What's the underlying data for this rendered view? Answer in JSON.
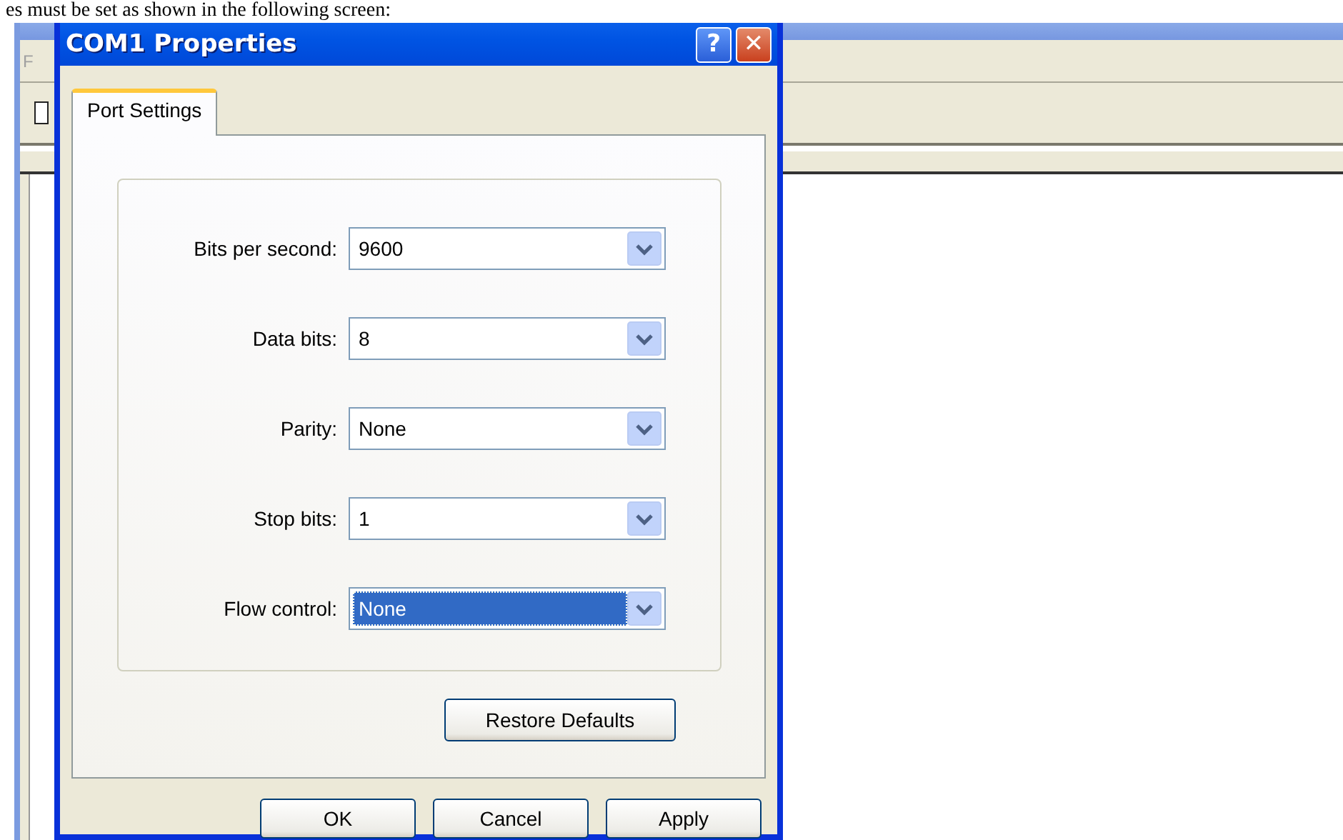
{
  "document": {
    "caption": "es must be set as shown in the following screen:"
  },
  "background_window": {
    "menu": [
      "F"
    ]
  },
  "dialog": {
    "title": "COM1 Properties",
    "title_buttons": [
      {
        "kind": "help",
        "label": "?"
      },
      {
        "kind": "close",
        "label": "✕"
      }
    ],
    "tabs": [
      {
        "label": "Port Settings",
        "selected": true
      }
    ],
    "fields": [
      {
        "label": "Bits per second:",
        "value": "9600",
        "focused": false
      },
      {
        "label": "Data bits:",
        "value": "8",
        "focused": false
      },
      {
        "label": "Parity:",
        "value": "None",
        "focused": false
      },
      {
        "label": "Stop bits:",
        "value": "1",
        "focused": false
      },
      {
        "label": "Flow control:",
        "value": "None",
        "focused": true
      }
    ],
    "restore_button": "Restore Defaults",
    "buttons": [
      "OK",
      "Cancel",
      "Apply"
    ]
  }
}
